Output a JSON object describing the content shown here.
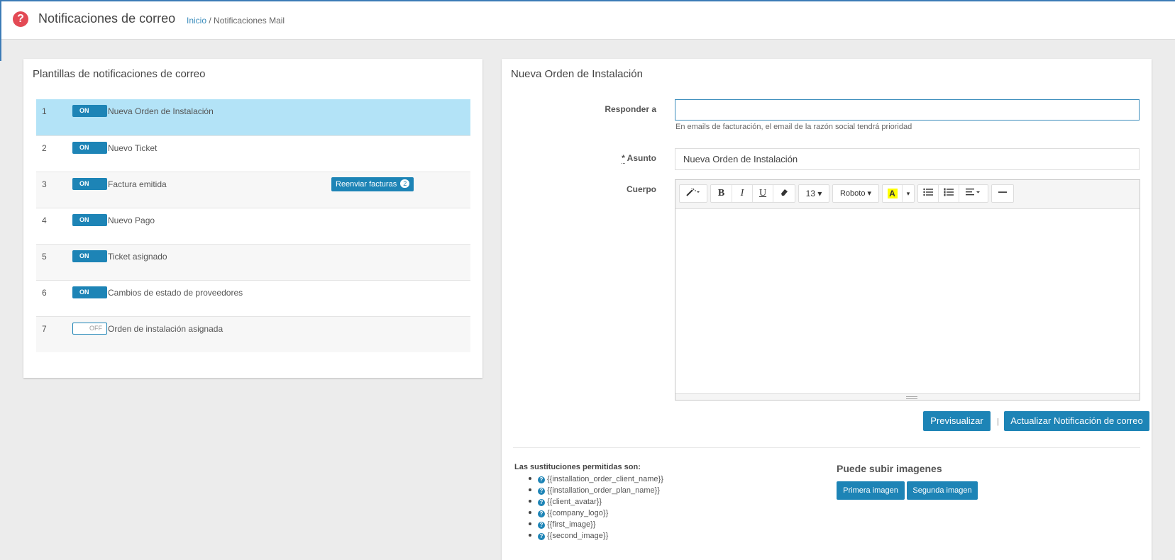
{
  "header": {
    "title": "Notificaciones de correo",
    "breadcrumb": {
      "home": "Inicio",
      "separator": "/",
      "current": "Notificaciones Mail"
    }
  },
  "templates_panel": {
    "title": "Plantillas de notificaciones de correo",
    "rows": [
      {
        "num": "1",
        "toggle": "ON",
        "name": "Nueva Orden de Instalación"
      },
      {
        "num": "2",
        "toggle": "ON",
        "name": "Nuevo Ticket"
      },
      {
        "num": "3",
        "toggle": "ON",
        "name": "Factura emitida",
        "action": "Reenviar facturas",
        "badge": "2"
      },
      {
        "num": "4",
        "toggle": "ON",
        "name": "Nuevo Pago"
      },
      {
        "num": "5",
        "toggle": "ON",
        "name": "Ticket asignado"
      },
      {
        "num": "6",
        "toggle": "ON",
        "name": "Cambios de estado de proveedores"
      },
      {
        "num": "7",
        "toggle": "OFF",
        "name": "Orden de instalación asignada"
      }
    ]
  },
  "editor_panel": {
    "title": "Nueva Orden de Instalación",
    "reply_to": {
      "label": "Responder a",
      "value": "",
      "help": "En emails de facturación, el email de la razón social tendrá prioridad"
    },
    "subject": {
      "label_marker": "*",
      "label": " Asunto",
      "value": "Nueva Orden de Instalación"
    },
    "body": {
      "label": "Cuerpo"
    },
    "toolbar": {
      "font_size": "13",
      "font_family": "Roboto",
      "bold": "B",
      "italic": "I",
      "underline": "U",
      "highlight": "A"
    },
    "buttons": {
      "preview": "Previsualizar",
      "separator": "|",
      "update": "Actualizar Notificación de correo"
    },
    "substitutions": {
      "title": "Las sustituciones permitidas son:",
      "items": [
        "{{installation_order_client_name}}",
        "{{installation_order_plan_name}}",
        "{{client_avatar}}",
        "{{company_logo}}",
        "{{first_image}}",
        "{{second_image}}"
      ]
    },
    "images": {
      "title": "Puede subir imagenes",
      "first": "Primera imagen",
      "second": "Segunda imagen"
    }
  },
  "colors": {
    "primary": "#1d84b6",
    "selected_row": "#b3e3f7",
    "help_icon": "#e34a55",
    "link": "#3c8dbc"
  }
}
